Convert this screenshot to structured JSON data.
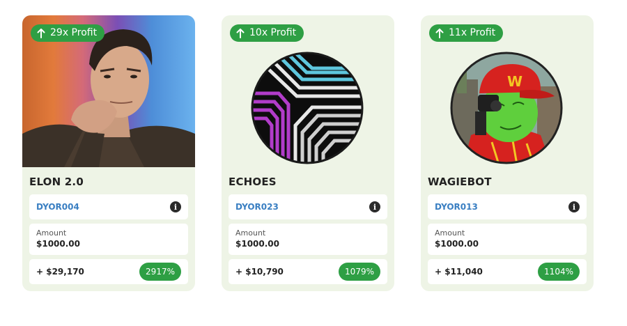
{
  "cards": [
    {
      "badge": "29x Profit",
      "name": "ELON 2.0",
      "code": "DYOR004",
      "amount_label": "Amount",
      "amount_value": "$1000.00",
      "gain": "+ $29,170",
      "percent": "2917%"
    },
    {
      "badge": "10x Profit",
      "name": "ECHOES",
      "code": "DYOR023",
      "amount_label": "Amount",
      "amount_value": "$1000.00",
      "gain": "+ $10,790",
      "percent": "1079%"
    },
    {
      "badge": "11x Profit",
      "name": "WAGIEBOT",
      "code": "DYOR013",
      "amount_label": "Amount",
      "amount_value": "$1000.00",
      "gain": "+ $11,040",
      "percent": "1104%"
    }
  ],
  "icons": {
    "badge": "arrow-up-icon",
    "info": "info-icon"
  },
  "colors": {
    "card_bg": "#eef4e6",
    "accent_green": "#2e9f44",
    "code_blue": "#3a7fc2"
  }
}
